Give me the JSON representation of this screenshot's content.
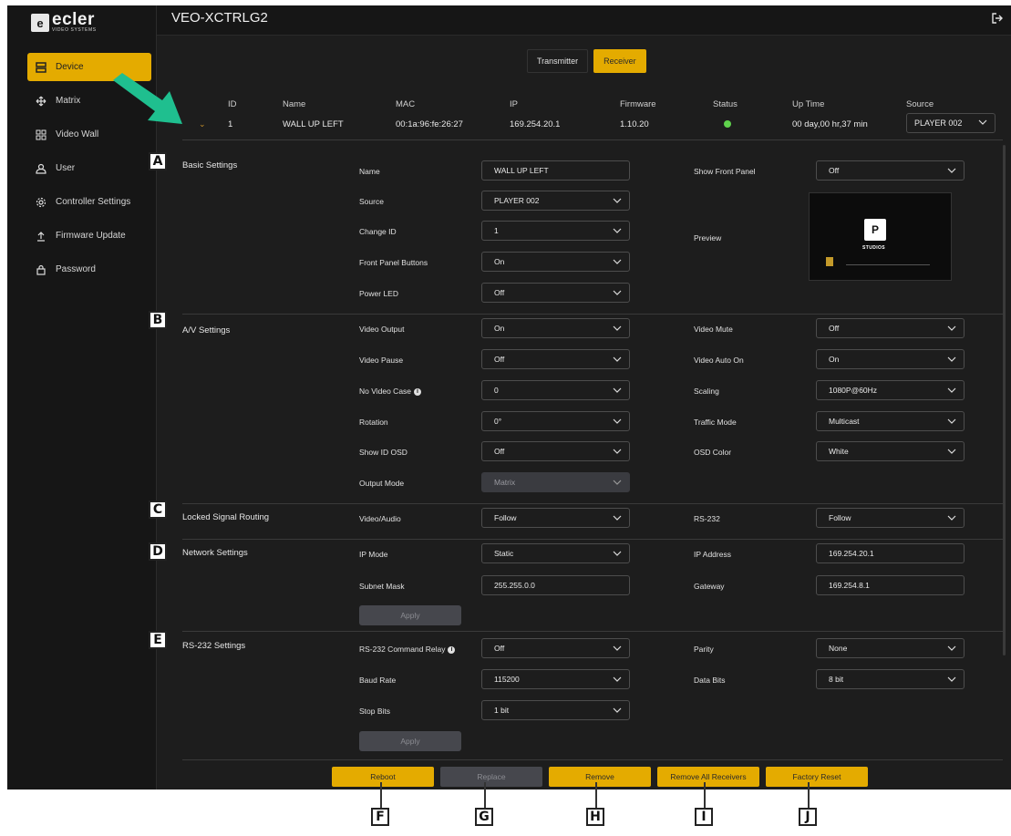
{
  "logo": {
    "name": "ecler",
    "sub": "VIDEO SYSTEMS"
  },
  "app": {
    "title": "VEO-XCTRLG2"
  },
  "sidebar": {
    "items": [
      {
        "label": "Device",
        "icon": "device-icon",
        "active": true
      },
      {
        "label": "Matrix",
        "icon": "matrix-icon"
      },
      {
        "label": "Video Wall",
        "icon": "video-wall-icon"
      },
      {
        "label": "User",
        "icon": "user-icon"
      },
      {
        "label": "Controller Settings",
        "icon": "gear-icon"
      },
      {
        "label": "Firmware Update",
        "icon": "upload-icon"
      },
      {
        "label": "Password",
        "icon": "lock-icon"
      }
    ]
  },
  "tabs": {
    "transmitter": "Transmitter",
    "receiver": "Receiver",
    "active": "receiver"
  },
  "device_table": {
    "headers": {
      "id": "ID",
      "name": "Name",
      "mac": "MAC",
      "ip": "IP",
      "firmware": "Firmware",
      "status": "Status",
      "uptime": "Up Time",
      "source": "Source"
    },
    "row": {
      "id": "1",
      "name": "WALL UP LEFT",
      "mac": "00:1a:96:fe:26:27",
      "ip": "169.254.20.1",
      "firmware": "1.10.20",
      "status": "online",
      "uptime": "00 day,00 hr,37 min",
      "source": "PLAYER 002"
    }
  },
  "basic": {
    "title": "Basic Settings",
    "name_label": "Name",
    "name_value": "WALL UP LEFT",
    "source_label": "Source",
    "source_value": "PLAYER 002",
    "change_id_label": "Change ID",
    "change_id_value": "1",
    "front_panel_buttons_label": "Front Panel Buttons",
    "front_panel_buttons_value": "On",
    "power_led_label": "Power LED",
    "power_led_value": "Off",
    "show_front_panel_label": "Show Front Panel",
    "show_front_panel_value": "Off",
    "preview_label": "Preview",
    "preview_studios": "STUDIOS"
  },
  "av": {
    "title": "A/V Settings",
    "video_output_label": "Video Output",
    "video_output_value": "On",
    "video_pause_label": "Video Pause",
    "video_pause_value": "Off",
    "no_video_case_label": "No Video Case",
    "no_video_case_value": "0",
    "rotation_label": "Rotation",
    "rotation_value": "0°",
    "show_id_osd_label": "Show ID OSD",
    "show_id_osd_value": "Off",
    "output_mode_label": "Output Mode",
    "output_mode_value": "Matrix",
    "video_mute_label": "Video Mute",
    "video_mute_value": "Off",
    "video_auto_on_label": "Video Auto On",
    "video_auto_on_value": "On",
    "scaling_label": "Scaling",
    "scaling_value": "1080P@60Hz",
    "traffic_mode_label": "Traffic Mode",
    "traffic_mode_value": "Multicast",
    "osd_color_label": "OSD Color",
    "osd_color_value": "White"
  },
  "locked": {
    "title": "Locked Signal Routing",
    "video_audio_label": "Video/Audio",
    "video_audio_value": "Follow",
    "rs232_label": "RS-232",
    "rs232_value": "Follow"
  },
  "network": {
    "title": "Network Settings",
    "ip_mode_label": "IP Mode",
    "ip_mode_value": "Static",
    "subnet_mask_label": "Subnet Mask",
    "subnet_mask_value": "255.255.0.0",
    "ip_address_label": "IP Address",
    "ip_address_value": "169.254.20.1",
    "gateway_label": "Gateway",
    "gateway_value": "169.254.8.1",
    "apply_label": "Apply"
  },
  "rs232": {
    "title": "RS-232 Settings",
    "command_relay_label": "RS-232 Command Relay",
    "command_relay_value": "Off",
    "baud_rate_label": "Baud Rate",
    "baud_rate_value": "115200",
    "stop_bits_label": "Stop Bits",
    "stop_bits_value": "1 bit",
    "parity_label": "Parity",
    "parity_value": "None",
    "data_bits_label": "Data Bits",
    "data_bits_value": "8 bit",
    "apply_label": "Apply"
  },
  "actions": {
    "reboot": "Reboot",
    "replace": "Replace",
    "remove": "Remove",
    "remove_all": "Remove All Receivers",
    "factory_reset": "Factory Reset"
  },
  "callouts": [
    "A",
    "B",
    "C",
    "D",
    "E",
    "F",
    "G",
    "H",
    "I",
    "J"
  ],
  "colors": {
    "accent": "#e4ab00",
    "background": "#1d1d1d",
    "status_online": "#5fd24c",
    "annotation_arrow": "#1fbf8f"
  }
}
